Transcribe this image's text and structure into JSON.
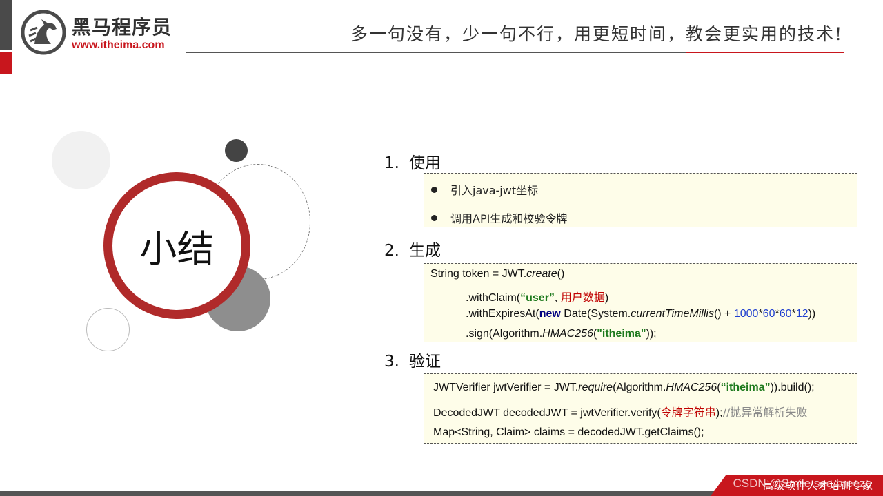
{
  "header": {
    "logo_cn": "黑马程序员",
    "logo_url": "www.itheima.com",
    "slogan": "多一句没有，少一句不行，用更短时间，教会更实用的技术!"
  },
  "summary_title": "小结",
  "sections": [
    {
      "number": "1.",
      "title": "使用",
      "bullets": [
        "引入java-jwt坐标",
        "调用API生成和校验令牌"
      ]
    },
    {
      "number": "2.",
      "title": "生成",
      "code": {
        "l1a": "String token = JWT.",
        "l1b": "create",
        "l1c": "()",
        "l2a": ".withClaim(",
        "l2b": "“user”",
        "l2c": ", ",
        "l2d": "用户数据",
        "l2e": ")",
        "l3a": ".withExpiresAt(",
        "l3b": "new",
        "l3c": " Date(System.",
        "l3d": "currentTimeMillis",
        "l3e": "() + ",
        "l3f": "1000",
        "l3g": "*",
        "l3h": "60",
        "l3i": "*",
        "l3j": "60",
        "l3k": "*",
        "l3l": "12",
        "l3m": "))",
        "l4a": ".sign(Algorithm.",
        "l4b": "HMAC256",
        "l4c": "(",
        "l4d": "\"itheima\"",
        "l4e": "));"
      }
    },
    {
      "number": "3.",
      "title": "验证",
      "code": {
        "l1a": "JWTVerifier jwtVerifier = JWT.",
        "l1b": "require",
        "l1c": "(Algorithm.",
        "l1d": "HMAC256",
        "l1e": "(",
        "l1f": "“itheima”",
        "l1g": ")).build();",
        "l2a": "DecodedJWT decodedJWT = jwtVerifier.verify(",
        "l2b": "令牌字符串",
        "l2c": ");",
        "l2d": "//抛异常解析失败",
        "l3a": "Map<String, Claim> claims = decodedJWT.getClaims();"
      }
    }
  ],
  "footer": {
    "text": "高级软件人才培训专家",
    "watermark": "CSDN @Smile sea breeze"
  },
  "colors": {
    "brand_red": "#c8161d",
    "ring_red": "#b02a2a",
    "box_bg": "#fefde9"
  }
}
